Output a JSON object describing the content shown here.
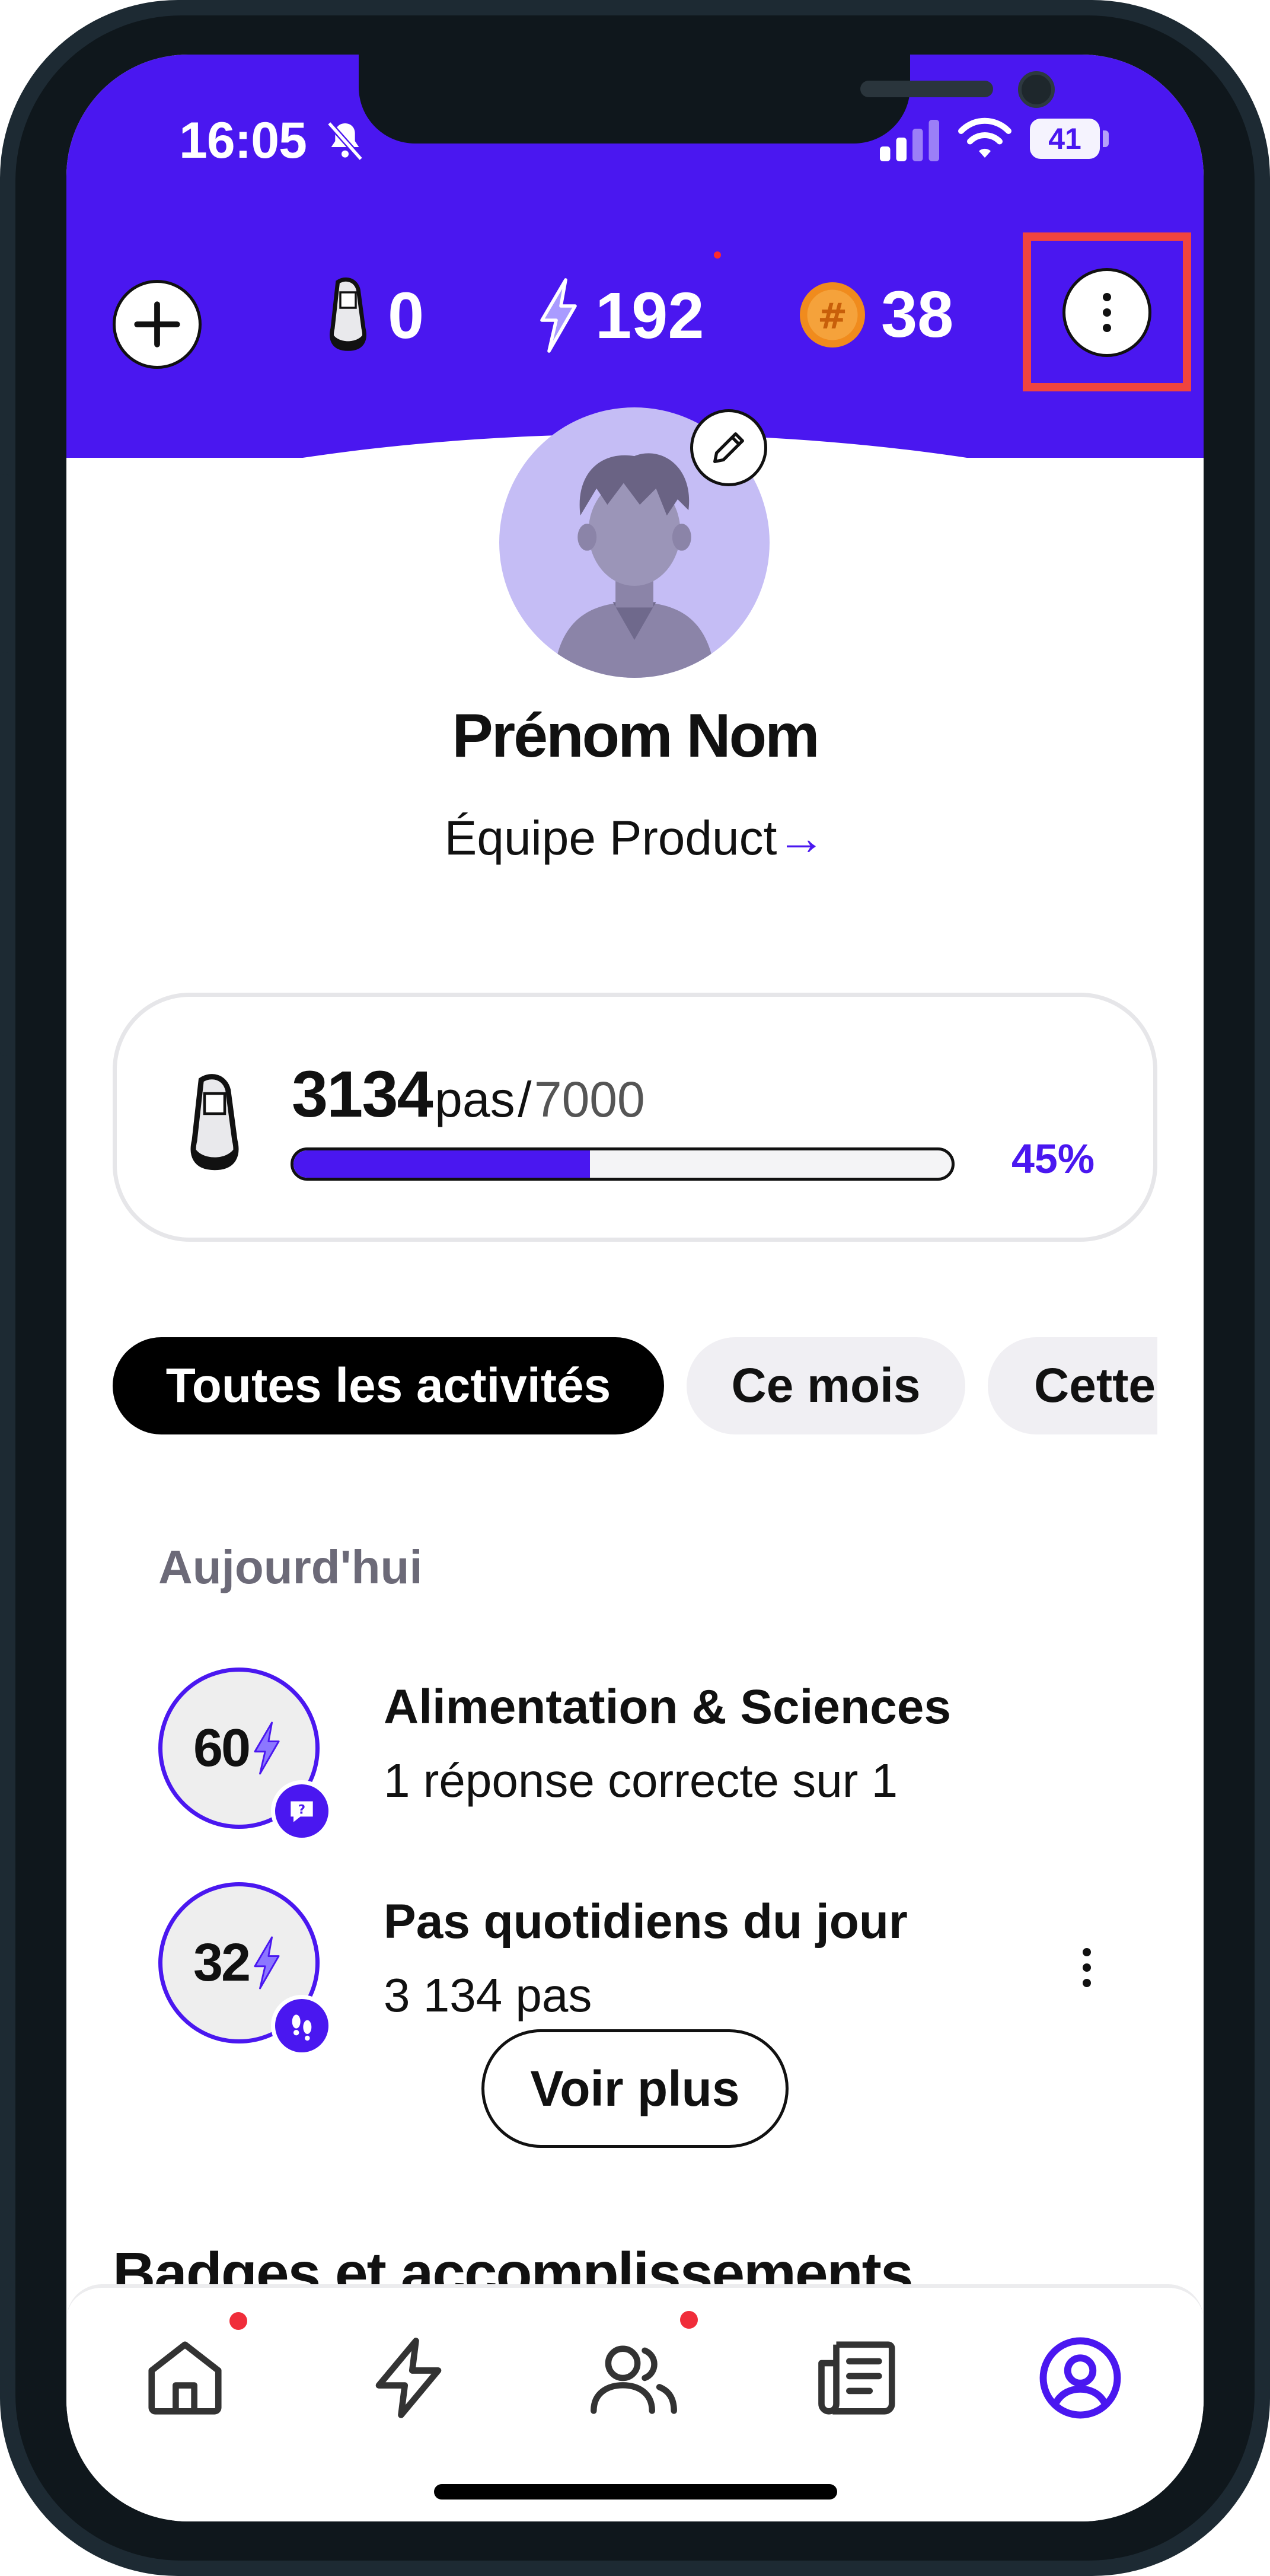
{
  "status_bar": {
    "time": "16:05",
    "battery": "41"
  },
  "header": {
    "steps_value": "0",
    "energy_value": "192",
    "coins_value": "38",
    "colors": {
      "brand": "#4a17f0",
      "coin": "#f08b1d"
    }
  },
  "profile": {
    "name": "Prénom Nom",
    "team": "Équipe Product",
    "team_arrow": "→"
  },
  "steps_card": {
    "count": "3134",
    "unit": "pas",
    "separator": "/",
    "goal": "7000",
    "progress_fraction": 0.45,
    "progress_label": "45%"
  },
  "filters": [
    "Toutes les activités",
    "Ce mois",
    "Cette semaine"
  ],
  "activities": {
    "section_label": "Aujourd'hui",
    "items": [
      {
        "points": "60",
        "title": "Alimentation & Sciences",
        "subtitle": "1 réponse correcte sur 1",
        "icon": "question-icon"
      },
      {
        "points": "32",
        "title": "Pas quotidiens du jour",
        "subtitle": "3 134 pas",
        "icon": "footsteps-icon"
      }
    ],
    "more_label": "Voir plus"
  },
  "badges_section_title": "Badges et accomplissements",
  "tab_bar": {
    "tabs": [
      {
        "name": "home",
        "icon": "home-icon",
        "has_dot": true
      },
      {
        "name": "energy",
        "icon": "lightning-icon",
        "has_dot": false
      },
      {
        "name": "team",
        "icon": "users-icon",
        "has_dot": true
      },
      {
        "name": "news",
        "icon": "newspaper-icon",
        "has_dot": false
      },
      {
        "name": "profile",
        "icon": "profile-icon",
        "has_dot": false,
        "active": true
      }
    ]
  }
}
